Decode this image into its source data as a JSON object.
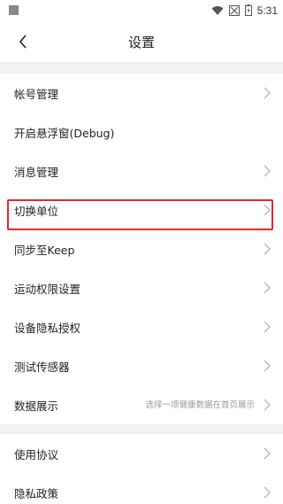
{
  "status": {
    "time": "5:31"
  },
  "header": {
    "title": "设置"
  },
  "section1": [
    {
      "label": "帐号管理",
      "chevron": true
    },
    {
      "label": "开启悬浮窗(Debug)",
      "chevron": false
    },
    {
      "label": "消息管理",
      "chevron": true
    },
    {
      "label": "切换单位",
      "chevron": true
    },
    {
      "label": "同步至Keep",
      "chevron": true
    },
    {
      "label": "运动权限设置",
      "chevron": true
    },
    {
      "label": "设备隐私授权",
      "chevron": true
    },
    {
      "label": "测试传感器",
      "chevron": true
    },
    {
      "label": "数据展示",
      "hint": "选择一项健康数据在首页展示",
      "chevron": true
    }
  ],
  "section2": [
    {
      "label": "使用协议",
      "chevron": true
    },
    {
      "label": "隐私政策",
      "chevron": true
    }
  ],
  "colors": {
    "highlight": "#e4282e"
  }
}
